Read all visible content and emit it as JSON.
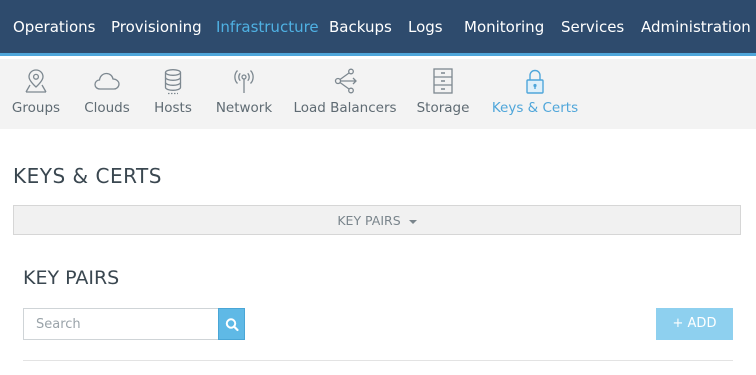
{
  "colors": {
    "nav_bg": "#2e4b6d",
    "nav_active": "#4fb1e3",
    "accent": "#4fa6da",
    "subnav_bg": "#f3f3f3",
    "add_button": "#8ed0ef"
  },
  "top_nav": {
    "items": [
      {
        "label": "Operations"
      },
      {
        "label": "Provisioning"
      },
      {
        "label": "Infrastructure",
        "active": true
      },
      {
        "label": "Backups"
      },
      {
        "label": "Logs"
      },
      {
        "label": "Monitoring"
      },
      {
        "label": "Services"
      },
      {
        "label": "Administration"
      }
    ]
  },
  "sub_nav": {
    "tabs": [
      {
        "label": "Groups",
        "icon": "map-pin-icon"
      },
      {
        "label": "Clouds",
        "icon": "cloud-icon"
      },
      {
        "label": "Hosts",
        "icon": "database-icon"
      },
      {
        "label": "Network",
        "icon": "antenna-icon"
      },
      {
        "label": "Load Balancers",
        "icon": "share-icon"
      },
      {
        "label": "Storage",
        "icon": "cabinet-icon"
      },
      {
        "label": "Keys & Certs",
        "icon": "lock-icon",
        "active": true
      }
    ]
  },
  "page": {
    "title": "KEYS & CERTS",
    "dropdown_label": "KEY PAIRS",
    "section_title": "KEY PAIRS",
    "search_placeholder": "Search",
    "search_value": "",
    "add_label": "+ ADD"
  }
}
